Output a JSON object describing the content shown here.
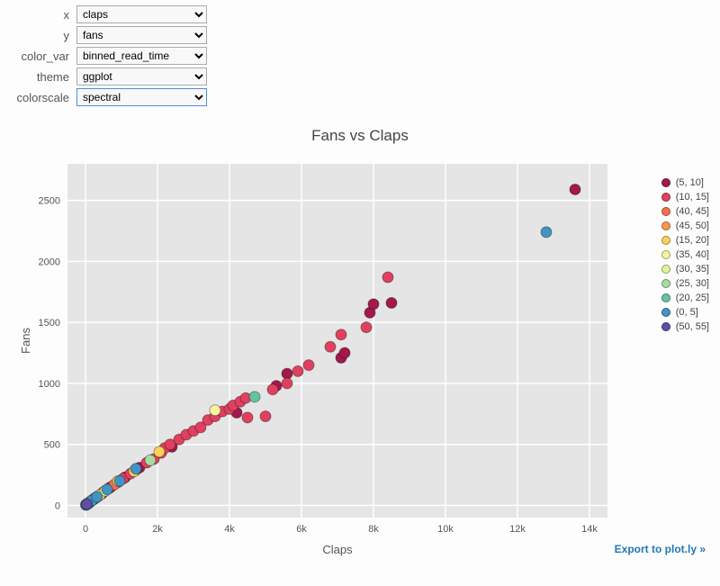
{
  "controls": {
    "x": {
      "label": "x",
      "value": "claps"
    },
    "y": {
      "label": "y",
      "value": "fans"
    },
    "color_var": {
      "label": "color_var",
      "value": "binned_read_time"
    },
    "theme": {
      "label": "theme",
      "value": "ggplot"
    },
    "colorscale": {
      "label": "colorscale",
      "value": "spectral"
    }
  },
  "export_link": "Export to plot.ly »",
  "chart_data": {
    "type": "scatter",
    "title": "Fans vs Claps",
    "xlabel": "Claps",
    "ylabel": "Fans",
    "xlim": [
      -500,
      14500
    ],
    "ylim": [
      -100,
      2800
    ],
    "x_ticks": [
      0,
      2000,
      4000,
      6000,
      8000,
      10000,
      12000,
      14000
    ],
    "x_tick_labels": [
      "0",
      "2k",
      "4k",
      "6k",
      "8k",
      "10k",
      "12k",
      "14k"
    ],
    "y_ticks": [
      0,
      500,
      1000,
      1500,
      2000,
      2500
    ],
    "legend": [
      {
        "name": "(5, 10]",
        "color": "#a3194b"
      },
      {
        "name": "(10, 15]",
        "color": "#e0405f"
      },
      {
        "name": "(40, 45]",
        "color": "#f0704f"
      },
      {
        "name": "(45, 50]",
        "color": "#f59b4a"
      },
      {
        "name": "(15, 20]",
        "color": "#f9d25a"
      },
      {
        "name": "(35, 40]",
        "color": "#f8f39d"
      },
      {
        "name": "(30, 35]",
        "color": "#e1f399"
      },
      {
        "name": "(25, 30]",
        "color": "#a5dca4"
      },
      {
        "name": "(20, 25]",
        "color": "#66c2a5"
      },
      {
        "name": "(0, 5]",
        "color": "#4393c3"
      },
      {
        "name": "(50, 55]",
        "color": "#5e4fa2"
      }
    ],
    "series": [
      {
        "name": "(5, 10]",
        "color": "#a3194b",
        "points": [
          [
            60,
            15
          ],
          [
            250,
            55
          ],
          [
            450,
            95
          ],
          [
            700,
            150
          ],
          [
            1100,
            230
          ],
          [
            1500,
            310
          ],
          [
            2400,
            480
          ],
          [
            4200,
            760
          ],
          [
            5300,
            980
          ],
          [
            5600,
            1080
          ],
          [
            7100,
            1210
          ],
          [
            7200,
            1250
          ],
          [
            7900,
            1580
          ],
          [
            8000,
            1650
          ],
          [
            8500,
            1660
          ],
          [
            13600,
            2590
          ]
        ]
      },
      {
        "name": "(10, 15]",
        "color": "#e0405f",
        "points": [
          [
            20,
            5
          ],
          [
            120,
            25
          ],
          [
            200,
            45
          ],
          [
            350,
            75
          ],
          [
            500,
            110
          ],
          [
            650,
            140
          ],
          [
            900,
            190
          ],
          [
            1050,
            220
          ],
          [
            1250,
            260
          ],
          [
            1400,
            290
          ],
          [
            1700,
            350
          ],
          [
            1900,
            380
          ],
          [
            2100,
            430
          ],
          [
            2200,
            470
          ],
          [
            2350,
            500
          ],
          [
            2600,
            540
          ],
          [
            2800,
            580
          ],
          [
            3000,
            610
          ],
          [
            3200,
            640
          ],
          [
            3400,
            700
          ],
          [
            3600,
            730
          ],
          [
            3800,
            770
          ],
          [
            4000,
            790
          ],
          [
            4100,
            820
          ],
          [
            4300,
            850
          ],
          [
            4450,
            880
          ],
          [
            4500,
            720
          ],
          [
            5000,
            730
          ],
          [
            5200,
            950
          ],
          [
            5600,
            1000
          ],
          [
            5900,
            1100
          ],
          [
            6200,
            1150
          ],
          [
            6800,
            1300
          ],
          [
            7100,
            1400
          ],
          [
            7800,
            1460
          ],
          [
            8400,
            1870
          ]
        ]
      },
      {
        "name": "(40, 45]",
        "color": "#f0704f",
        "points": [
          [
            800,
            170
          ]
        ]
      },
      {
        "name": "(45, 50]",
        "color": "#f59b4a",
        "points": [
          [
            300,
            65
          ]
        ]
      },
      {
        "name": "(15, 20]",
        "color": "#f9d25a",
        "points": [
          [
            150,
            35
          ],
          [
            400,
            85
          ],
          [
            900,
            200
          ],
          [
            1350,
            280
          ],
          [
            2050,
            440
          ]
        ]
      },
      {
        "name": "(35, 40]",
        "color": "#f8f39d",
        "points": [
          [
            3600,
            780
          ]
        ]
      },
      {
        "name": "(30, 35]",
        "color": "#e1f399",
        "points": [
          [
            550,
            120
          ]
        ]
      },
      {
        "name": "(25, 30]",
        "color": "#a5dca4",
        "points": [
          [
            1800,
            370
          ]
        ]
      },
      {
        "name": "(20, 25]",
        "color": "#66c2a5",
        "points": [
          [
            260,
            60
          ],
          [
            4700,
            890
          ]
        ]
      },
      {
        "name": "(0, 5]",
        "color": "#4393c3",
        "points": [
          [
            10,
            4
          ],
          [
            30,
            8
          ],
          [
            55,
            12
          ],
          [
            90,
            20
          ],
          [
            180,
            40
          ],
          [
            320,
            70
          ],
          [
            600,
            130
          ],
          [
            950,
            200
          ],
          [
            1400,
            300
          ],
          [
            12800,
            2240
          ]
        ]
      },
      {
        "name": "(50, 55]",
        "color": "#5e4fa2",
        "points": [
          [
            40,
            10
          ]
        ]
      }
    ]
  }
}
